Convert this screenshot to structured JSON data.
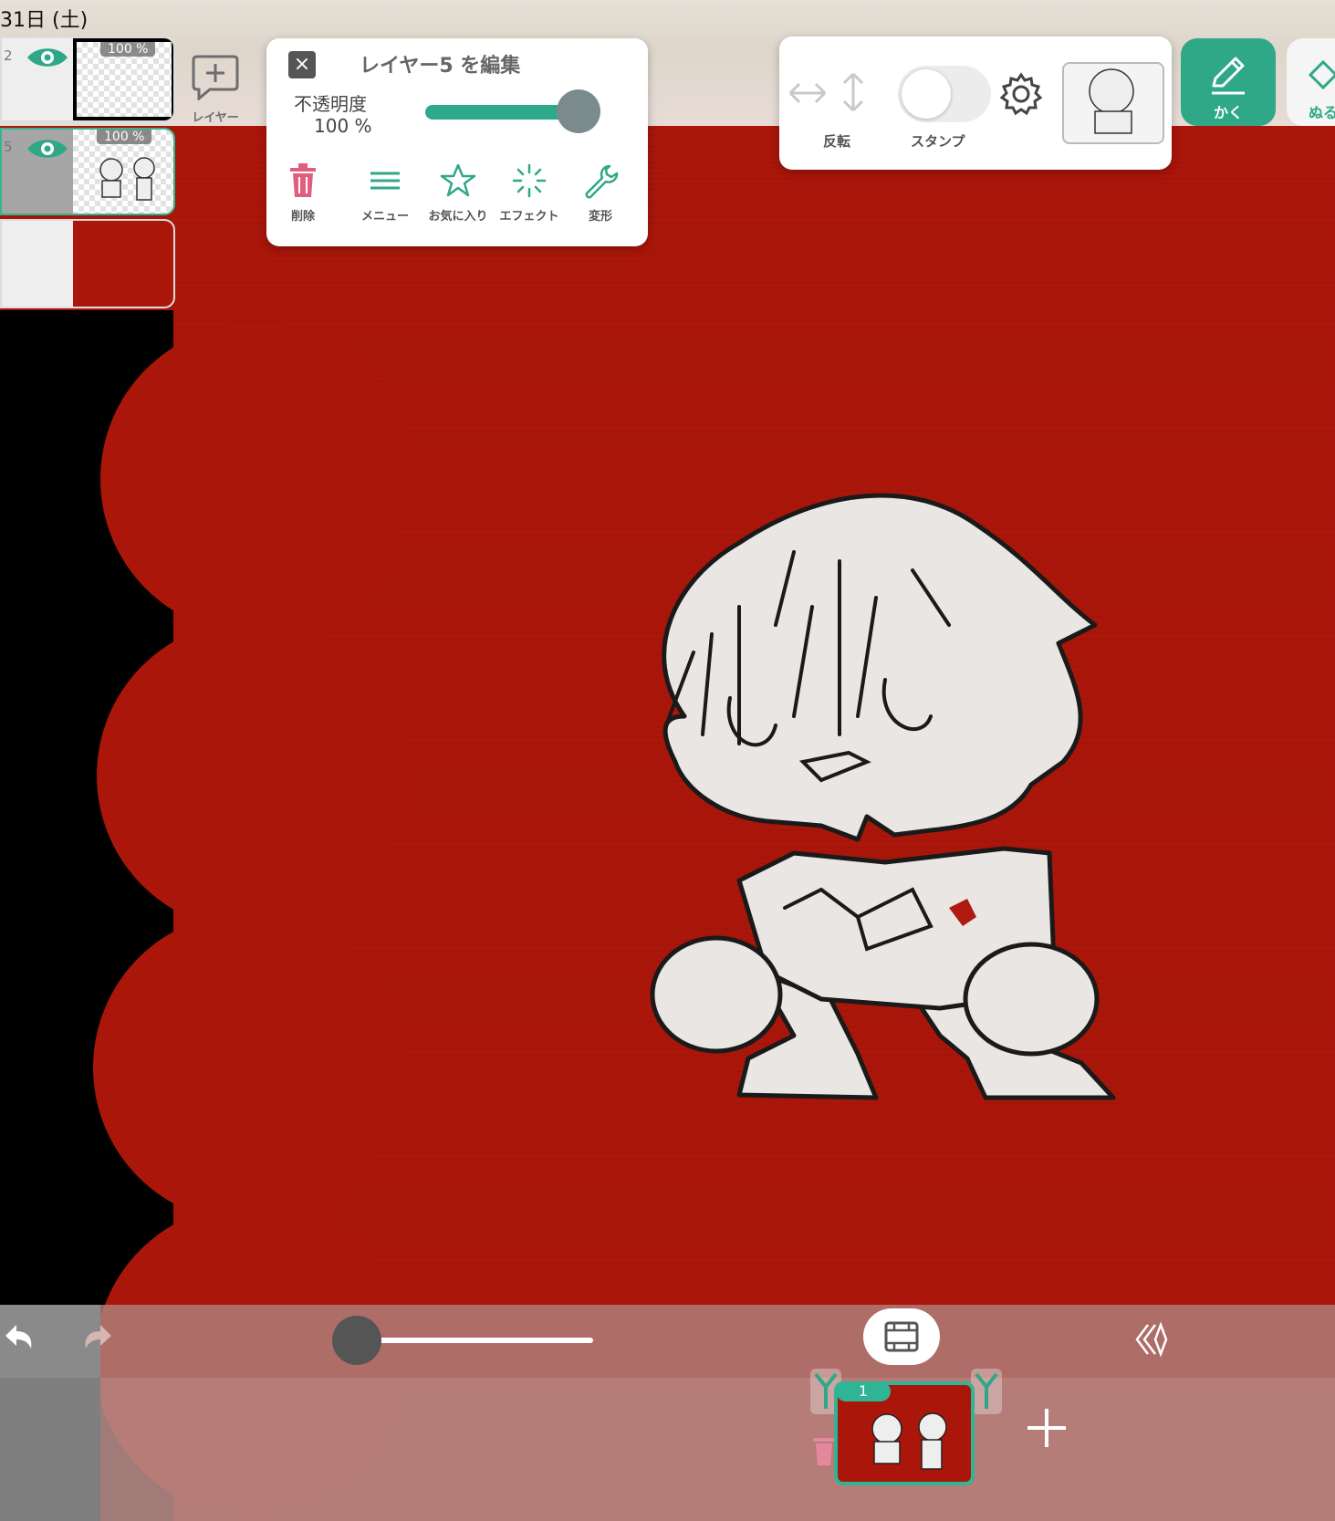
{
  "status_bar": {
    "date": "31日 (土)"
  },
  "layers": [
    {
      "number": "2",
      "opacity": "100 %",
      "type": "transparent"
    },
    {
      "number": "5",
      "opacity": "100 %",
      "type": "drawing",
      "selected": true
    },
    {
      "number": "",
      "opacity": "",
      "type": "fill-red"
    }
  ],
  "add_layer": {
    "label": "レイヤー"
  },
  "edit_panel": {
    "title": "レイヤー5 を編集",
    "opacity_label": "不透明度",
    "opacity_value": "100 %",
    "opacity_fraction": 1.0,
    "tools": [
      {
        "label": "削除",
        "icon": "trash-icon",
        "color": "#e05f7f"
      },
      {
        "label": "メニュー",
        "icon": "menu-icon",
        "color": "#2fa887"
      },
      {
        "label": "お気に入り",
        "icon": "star-icon",
        "color": "#2fa887"
      },
      {
        "label": "エフェクト",
        "icon": "sparkle-icon",
        "color": "#2fa887"
      },
      {
        "label": "変形",
        "icon": "wrench-icon",
        "color": "#2fa887"
      }
    ]
  },
  "right_panel": {
    "flip_label": "反転",
    "stamp_label": "スタンプ",
    "stamp_enabled": false
  },
  "main_tools": {
    "draw_label": "かく",
    "paint_label": "ぬる"
  },
  "timeline": {
    "frame_number": "1",
    "position_fraction": 0.0
  },
  "colors": {
    "accent": "#2fa887",
    "canvas": "#ab160a",
    "delete": "#e05f7f"
  }
}
